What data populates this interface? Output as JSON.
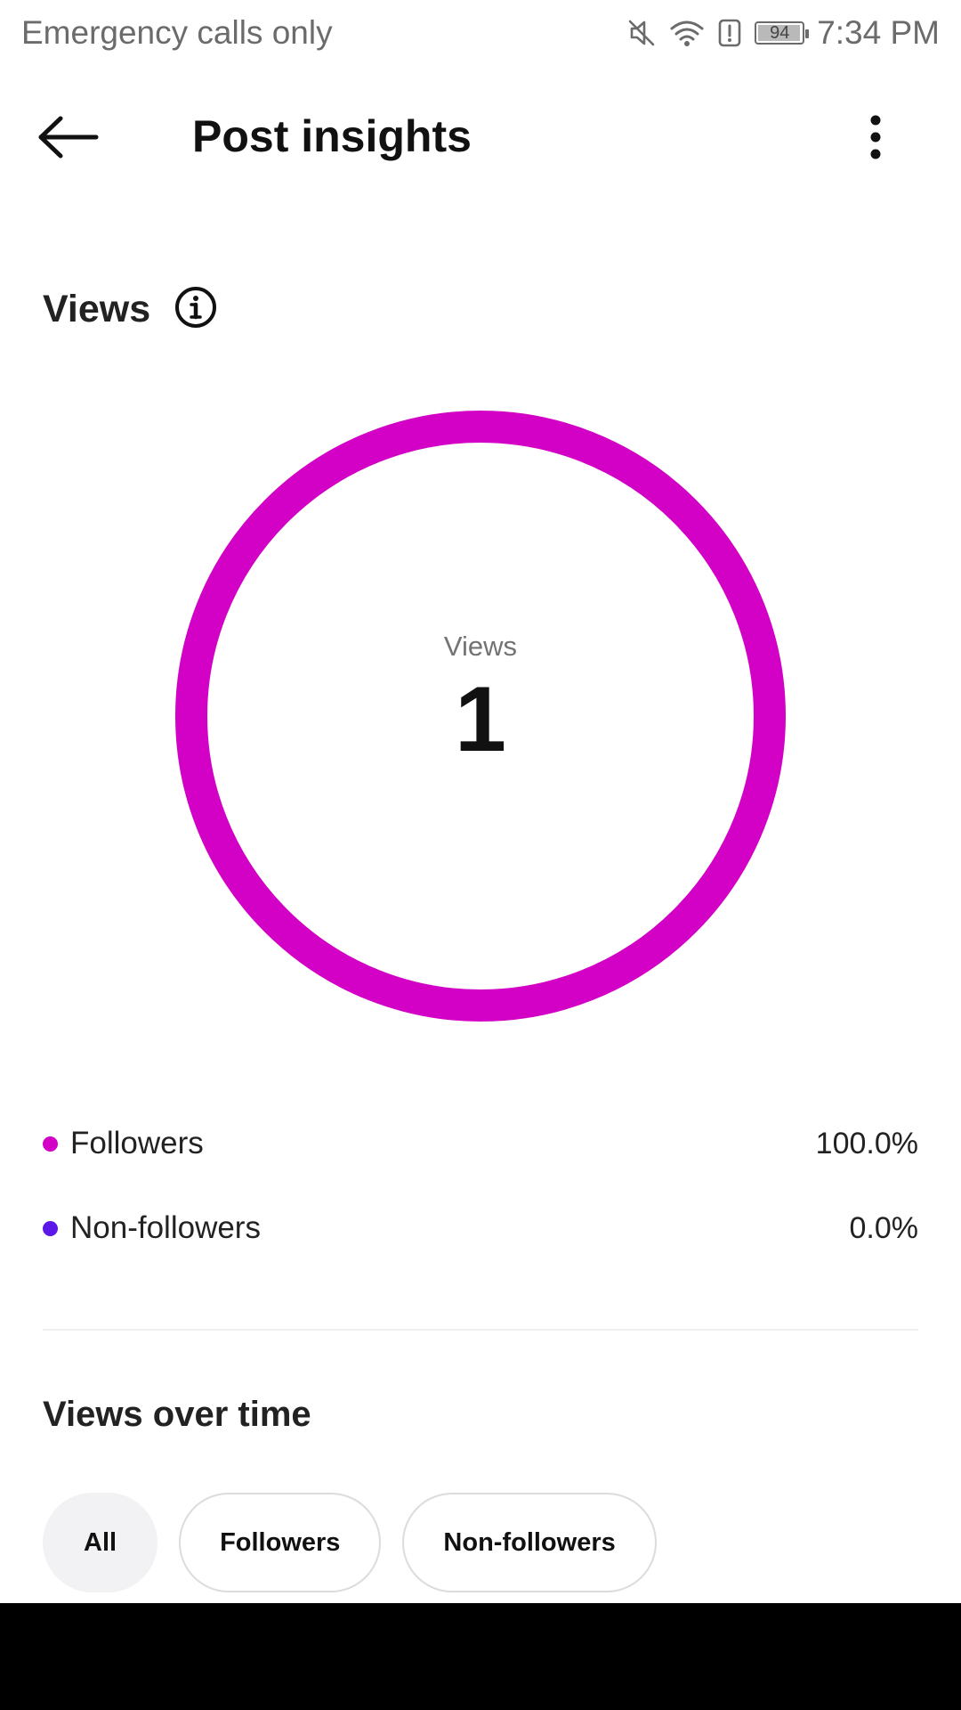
{
  "status_bar": {
    "carrier_text": "Emergency calls only",
    "icons": [
      "mute-icon",
      "wifi-icon",
      "alert-icon",
      "battery-icon"
    ],
    "battery_level": "94",
    "time": "7:34 PM"
  },
  "header": {
    "title": "Post insights",
    "back_icon": "arrow-left-icon",
    "more_icon": "more-vertical-icon"
  },
  "views_section": {
    "heading": "Views",
    "info_icon": "info-icon",
    "center_label": "Views",
    "center_value": "1",
    "legend": [
      {
        "label": "Followers",
        "value": "100.0%",
        "color": "#d300c5"
      },
      {
        "label": "Non-followers",
        "value": "0.0%",
        "color": "#5b18e8"
      }
    ]
  },
  "chart_data": {
    "type": "pie",
    "donut": true,
    "categories": [
      "Followers",
      "Non-followers"
    ],
    "values": [
      100.0,
      0.0
    ],
    "colors": [
      "#d300c5",
      "#5b18e8"
    ],
    "title": "",
    "center_text": "Views 1"
  },
  "views_over_time": {
    "heading": "Views over time",
    "filters": [
      {
        "label": "All",
        "selected": true
      },
      {
        "label": "Followers",
        "selected": false
      },
      {
        "label": "Non-followers",
        "selected": false
      }
    ]
  },
  "colors": {
    "accent": "#d300c5",
    "secondary": "#5b18e8",
    "nav_bar": "#000000"
  }
}
